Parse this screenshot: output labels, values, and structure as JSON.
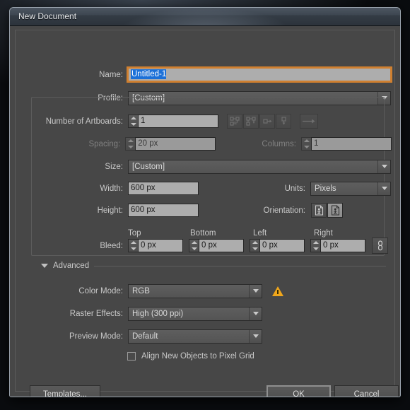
{
  "window": {
    "title": "New Document"
  },
  "fields": {
    "name": {
      "label": "Name:",
      "value": "Untitled-1"
    },
    "profile": {
      "label": "Profile:",
      "value": "[Custom]"
    },
    "artboards": {
      "label": "Number of Artboards:",
      "value": "1"
    },
    "spacing": {
      "label": "Spacing:",
      "value": "20 px"
    },
    "columns": {
      "label": "Columns:",
      "value": "1"
    },
    "size": {
      "label": "Size:",
      "value": "[Custom]"
    },
    "width": {
      "label": "Width:",
      "value": "600 px"
    },
    "height": {
      "label": "Height:",
      "value": "600 px"
    },
    "units": {
      "label": "Units:",
      "value": "Pixels"
    },
    "orientation": {
      "label": "Orientation:"
    },
    "bleed": {
      "label": "Bleed:",
      "top_header": "Top",
      "bottom_header": "Bottom",
      "left_header": "Left",
      "right_header": "Right",
      "top": "0 px",
      "bottom": "0 px",
      "left": "0 px",
      "right": "0 px"
    }
  },
  "advanced": {
    "section_label": "Advanced",
    "color_mode": {
      "label": "Color Mode:",
      "value": "RGB"
    },
    "raster_effects": {
      "label": "Raster Effects:",
      "value": "High (300 ppi)"
    },
    "preview_mode": {
      "label": "Preview Mode:",
      "value": "Default"
    },
    "align_pixel_grid": {
      "label": "Align New Objects to Pixel Grid",
      "checked": false
    }
  },
  "footer": {
    "templates": "Templates...",
    "ok": "OK",
    "cancel": "Cancel"
  },
  "colors": {
    "dialog_bg": "#474747",
    "input_bg": "#adadad",
    "focus_accent": "#d08030",
    "selection_blue": "#1b70d8",
    "warning_amber": "#f0a71c",
    "label_text": "#c8c8c8"
  }
}
